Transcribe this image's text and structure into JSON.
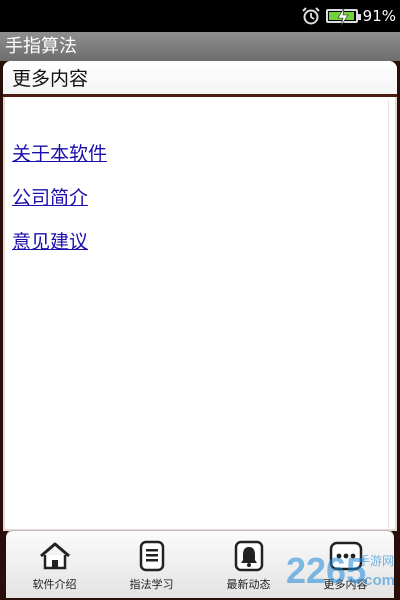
{
  "status_bar": {
    "battery_percent": "91%",
    "battery_level": 0.91,
    "alarm_icon": "alarm-clock-icon",
    "battery_icon": "battery-charging-icon"
  },
  "app": {
    "title": "手指算法"
  },
  "panel": {
    "title": "更多内容",
    "links": [
      {
        "label": "关于本软件"
      },
      {
        "label": "公司简介"
      },
      {
        "label": "意见建议"
      }
    ]
  },
  "tabs": [
    {
      "label": "软件介绍",
      "icon": "home-icon"
    },
    {
      "label": "指法学习",
      "icon": "document-list-icon"
    },
    {
      "label": "最新动态",
      "icon": "bell-icon"
    },
    {
      "label": "更多内容",
      "icon": "more-dots-icon",
      "selected": true
    }
  ],
  "watermark": {
    "text_main": "2265",
    "text_site": "手游网",
    "text_domain": ".com"
  },
  "colors": {
    "link": "#1a0dab",
    "header_border": "#4a1a13",
    "titlebar": "#7e7e7e",
    "watermark_blue": "#1e88d8"
  }
}
